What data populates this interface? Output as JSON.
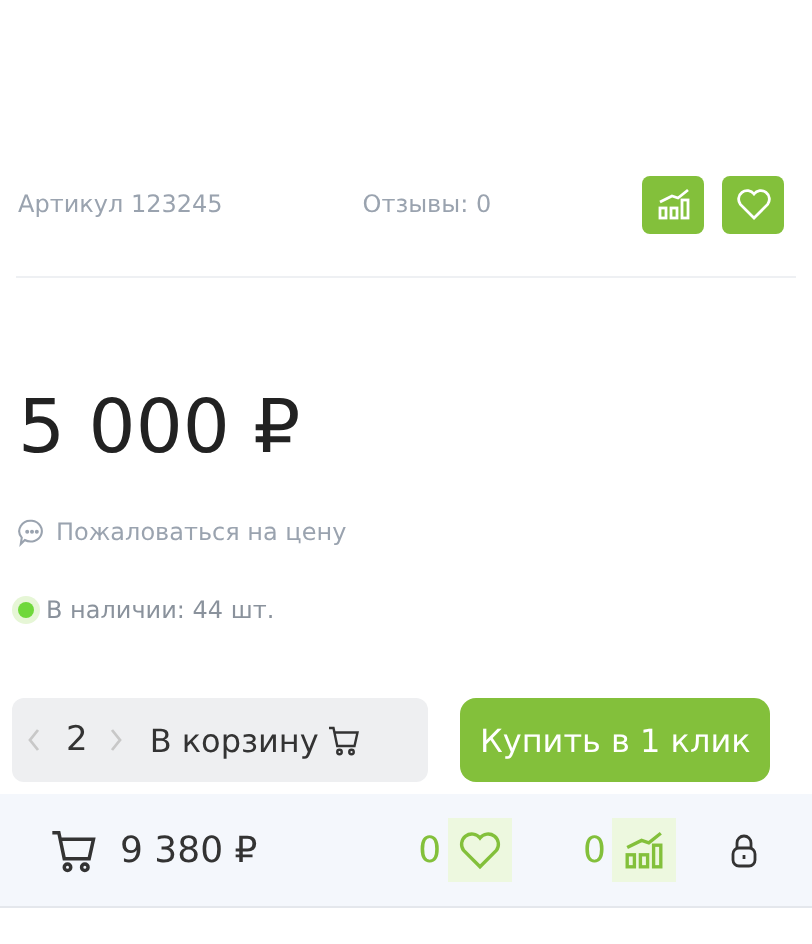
{
  "article": "Артикул 123245",
  "reviews": "Отзывы: 0",
  "price": "5 000 ₽",
  "complaint": "Пожаловаться на цену",
  "stock": {
    "text": "В наличии: 44 шт.",
    "available": true
  },
  "quantity": "2",
  "cart_button": "В корзину",
  "buy_button": "Купить в 1 клик",
  "bottom_bar": {
    "cart_total": "9 380 ₽",
    "favorites_count": "0",
    "compare_count": "0"
  }
}
